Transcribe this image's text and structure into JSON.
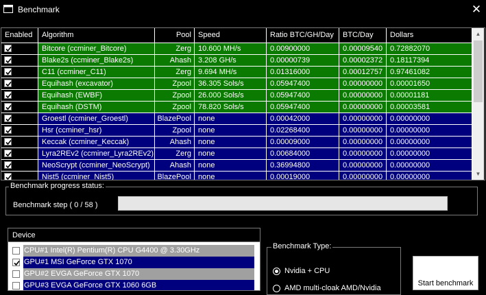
{
  "window": {
    "title": "Benchmark"
  },
  "icons": {
    "app": "window-icon",
    "close": "close-x-icon",
    "check": "check-mark-icon"
  },
  "colors": {
    "row_green": "#0a7a00",
    "row_blue": "#00007f",
    "row_gray": "#a0a0a0",
    "background": "#000000"
  },
  "table": {
    "columns": [
      "Enabled",
      "Algorithm",
      "Pool",
      "Speed",
      "Ratio BTC/GH/Day",
      "BTC/Day",
      "Dollars"
    ],
    "rows": [
      {
        "enabled": true,
        "algorithm": "Bitcore (ccminer_Bitcore)",
        "pool": "Zerg",
        "speed": "10.600 MH/s",
        "ratio": "0.00900000",
        "btc_day": "0.00009540",
        "dollars": "0.72882070",
        "color": "green"
      },
      {
        "enabled": true,
        "algorithm": "Blake2s (ccminer_Blake2s)",
        "pool": "Ahash",
        "speed": "3.208 GH/s",
        "ratio": "0.00000739",
        "btc_day": "0.00002372",
        "dollars": "0.18117394",
        "color": "green"
      },
      {
        "enabled": true,
        "algorithm": "C11 (ccminer_C11)",
        "pool": "Zerg",
        "speed": "9.694 MH/s",
        "ratio": "0.01316000",
        "btc_day": "0.00012757",
        "dollars": "0.97461082",
        "color": "green"
      },
      {
        "enabled": true,
        "algorithm": "Equihash (excavator)",
        "pool": "Zpool",
        "speed": "36.305 Sols/s",
        "ratio": "0.05947400",
        "btc_day": "0.00000000",
        "dollars": "0.00001650",
        "color": "green"
      },
      {
        "enabled": true,
        "algorithm": "Equihash (EWBF)",
        "pool": "Zpool",
        "speed": "26.000 Sols/s",
        "ratio": "0.05947400",
        "btc_day": "0.00000000",
        "dollars": "0.00001181",
        "color": "green"
      },
      {
        "enabled": true,
        "algorithm": "Equihash (DSTM)",
        "pool": "Zpool",
        "speed": "78.820 Sols/s",
        "ratio": "0.05947400",
        "btc_day": "0.00000000",
        "dollars": "0.00003581",
        "color": "green"
      },
      {
        "enabled": true,
        "algorithm": "Groestl (ccminer_Groestl)",
        "pool": "BlazePool",
        "speed": "none",
        "ratio": "0.00042000",
        "btc_day": "0.00000000",
        "dollars": "0.00000000",
        "color": "blue"
      },
      {
        "enabled": true,
        "algorithm": "Hsr (ccminer_hsr)",
        "pool": "Zpool",
        "speed": "none",
        "ratio": "0.02268400",
        "btc_day": "0.00000000",
        "dollars": "0.00000000",
        "color": "blue"
      },
      {
        "enabled": true,
        "algorithm": "Keccak (ccminer_Keccak)",
        "pool": "Ahash",
        "speed": "none",
        "ratio": "0.00009000",
        "btc_day": "0.00000000",
        "dollars": "0.00000000",
        "color": "blue"
      },
      {
        "enabled": true,
        "algorithm": "Lyra2REv2 (ccminer_Lyra2REv2)",
        "pool": "Zerg",
        "speed": "none",
        "ratio": "0.00684000",
        "btc_day": "0.00000000",
        "dollars": "0.00000000",
        "color": "blue"
      },
      {
        "enabled": true,
        "algorithm": "NeoScrypt (ccminer_NeoScrypt)",
        "pool": "Ahash",
        "speed": "none",
        "ratio": "0.36994800",
        "btc_day": "0.00000000",
        "dollars": "0.00000000",
        "color": "blue"
      },
      {
        "enabled": true,
        "algorithm": "Nist5 (ccminer_Nist5)",
        "pool": "BlazePool",
        "speed": "none",
        "ratio": "0.00019000",
        "btc_day": "0.00000000",
        "dollars": "0.00000000",
        "color": "blue"
      }
    ]
  },
  "progress": {
    "group_label": "Benchmark progress status:",
    "step_label": "Benchmark step ( 0 / 58 )",
    "fraction": 0
  },
  "devices": {
    "header": "Device",
    "items": [
      {
        "name": "CPU#1 Intel(R) Pentium(R) CPU G4400 @ 3.30GHz",
        "checked": false,
        "color": "gray"
      },
      {
        "name": "GPU#1 MSI GeForce GTX 1070",
        "checked": true,
        "color": "blue"
      },
      {
        "name": "GPU#2 EVGA GeForce GTX 1070",
        "checked": false,
        "color": "gray"
      },
      {
        "name": "GPU#3 EVGA GeForce GTX 1060 6GB",
        "checked": false,
        "color": "blue"
      }
    ]
  },
  "benchmark_type": {
    "label": "Benchmark Type:",
    "options": [
      {
        "label": "Nvidia + CPU",
        "selected": true
      },
      {
        "label": "AMD multi-cloak AMD/Nvidia",
        "selected": false
      }
    ]
  },
  "start_button": {
    "label": "Start benchmark"
  }
}
